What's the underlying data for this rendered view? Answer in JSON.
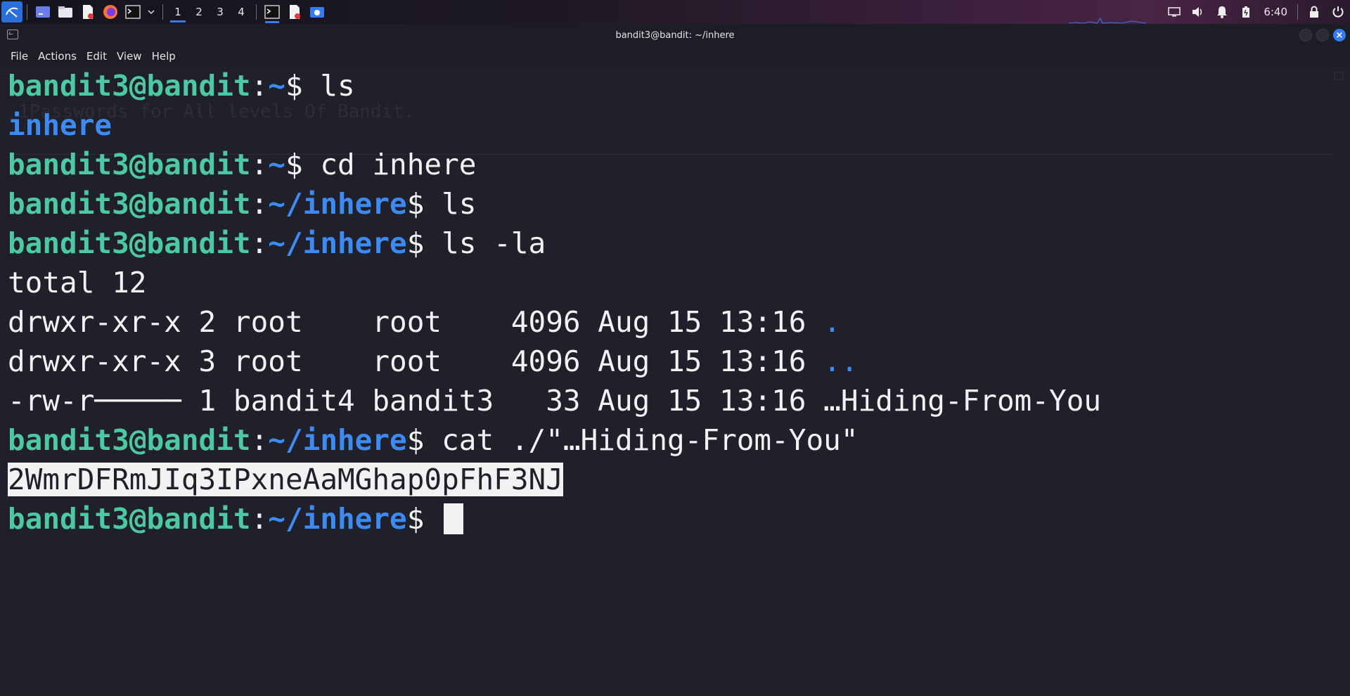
{
  "panel": {
    "workspaces": [
      "1",
      "2",
      "3",
      "4"
    ],
    "active_workspace": "1",
    "clock": "6:40",
    "launchers": [
      "kali-menu-icon",
      "show-desktop-icon",
      "file-manager-icon",
      "text-editor-icon",
      "firefox-icon",
      "terminal-icon",
      "dropdown-icon"
    ],
    "tasks": [
      "terminal-task-icon",
      "text-editor-task-icon",
      "screenshot-task-icon"
    ],
    "tray": [
      "display-icon",
      "volume-icon",
      "notifications-icon",
      "battery-icon",
      "lock-icon",
      "power-icon"
    ],
    "accent": "#367bf0"
  },
  "window": {
    "title": "bandit3@bandit: ~/inhere",
    "menu": [
      "File",
      "Actions",
      "Edit",
      "View",
      "Help"
    ]
  },
  "terminal": {
    "prompt_user": "bandit3@bandit",
    "colors": {
      "prompt": "#4cc9a3",
      "path": "#3d8bf2",
      "text": "#f2f2f2",
      "bg": "#1f2029"
    },
    "lines": [
      {
        "type": "prompt",
        "path": "~",
        "cmd": " ls"
      },
      {
        "type": "dir",
        "text": "inhere"
      },
      {
        "type": "prompt",
        "path": "~",
        "cmd": " cd inhere"
      },
      {
        "type": "prompt",
        "path": "~/inhere",
        "cmd": " ls"
      },
      {
        "type": "prompt",
        "path": "~/inhere",
        "cmd": " ls -la"
      },
      {
        "type": "out",
        "text": "total 12"
      },
      {
        "type": "ls",
        "text": "drwxr-xr-x 2 root    root    4096 Aug 15 13:16 ",
        "name": "."
      },
      {
        "type": "ls",
        "text": "drwxr-xr-x 3 root    root    4096 Aug 15 13:16 ",
        "name": ".."
      },
      {
        "type": "out",
        "text": "-rw-r───── 1 bandit4 bandit3   33 Aug 15 13:16 …Hiding-From-You"
      },
      {
        "type": "prompt",
        "path": "~/inhere",
        "cmd": " cat ./\"…Hiding-From-You\""
      },
      {
        "type": "selected",
        "text": "2WmrDFRmJIq3IPxneAaMGhap0pFhF3NJ"
      },
      {
        "type": "prompt-cursor",
        "path": "~/inhere",
        "cmd": ""
      }
    ],
    "background_ghost_text": [
      "1Passwords for All levels Of Bandit."
    ]
  }
}
